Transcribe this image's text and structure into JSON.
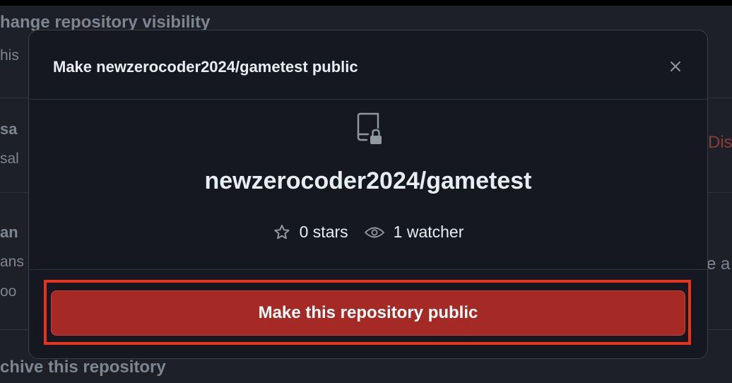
{
  "background": {
    "visibility_heading": "hange repository visibility",
    "visibility_desc": "his",
    "section2_line1": "sa",
    "section2_line2": "sal",
    "section2_action": "Dis",
    "section3_line1": "an",
    "section3_line2": "ans",
    "section3_line3": "oo",
    "section3_right": "e a",
    "archive_heading": "chive this repository"
  },
  "modal": {
    "title": "Make newzerocoder2024/gametest public",
    "close_icon": "x-icon",
    "repo_icon": "repo-locked-icon",
    "repo_name": "newzerocoder2024/gametest",
    "stars_label": "0 stars",
    "watchers_label": "1 watcher",
    "confirm_button": "Make this repository public"
  },
  "colors": {
    "danger_button": "#a52a25",
    "highlight": "#e8321b"
  }
}
